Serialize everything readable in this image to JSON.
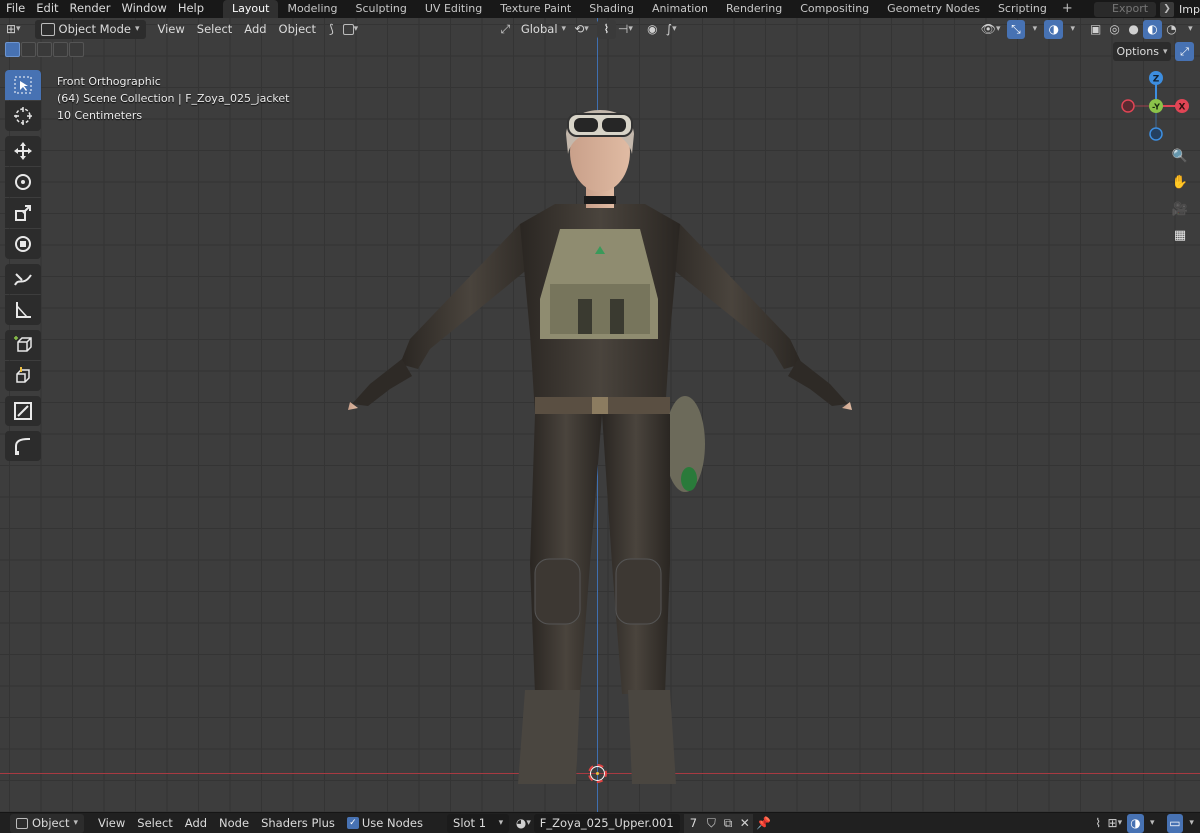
{
  "topbar": {
    "menus": [
      "File",
      "Edit",
      "Render",
      "Window",
      "Help"
    ],
    "workspaces": [
      "Layout",
      "Modeling",
      "Sculpting",
      "UV Editing",
      "Texture Paint",
      "Shading",
      "Animation",
      "Rendering",
      "Compositing",
      "Geometry Nodes",
      "Scripting"
    ],
    "active_workspace": "Layout",
    "add_tab": "+",
    "export_label": "Export",
    "scene_label": "Imp"
  },
  "viewport_header": {
    "mode": "Object Mode",
    "menus": [
      "View",
      "Select",
      "Add",
      "Object"
    ],
    "transform_orientation": "Global"
  },
  "viewport_info": {
    "view_name": "Front Orthographic",
    "collection": "(64) Scene Collection | F_Zoya_025_jacket",
    "scale": "10 Centimeters"
  },
  "options_label": "Options",
  "gizmo": {
    "z": "Z",
    "y": "-Y",
    "x": "X"
  },
  "colors": {
    "accent": "#4772b3",
    "x_axis": "#e04555",
    "y_axis": "#8bc34a",
    "z_axis": "#3d8ee0"
  },
  "toolbar": {
    "tools": [
      "select-box",
      "cursor",
      "move",
      "rotate",
      "scale",
      "transform",
      "annotate",
      "measure",
      "add-cube",
      "extrude",
      "grease-pencil",
      "curve"
    ]
  },
  "bottombar": {
    "editor": "Object",
    "menus": [
      "View",
      "Select",
      "Add",
      "Node",
      "Shaders Plus"
    ],
    "use_nodes_label": "Use Nodes",
    "use_nodes_checked": true,
    "slot": "Slot 1",
    "material_name": "F_Zoya_025_Upper.001",
    "user_count": "7"
  }
}
